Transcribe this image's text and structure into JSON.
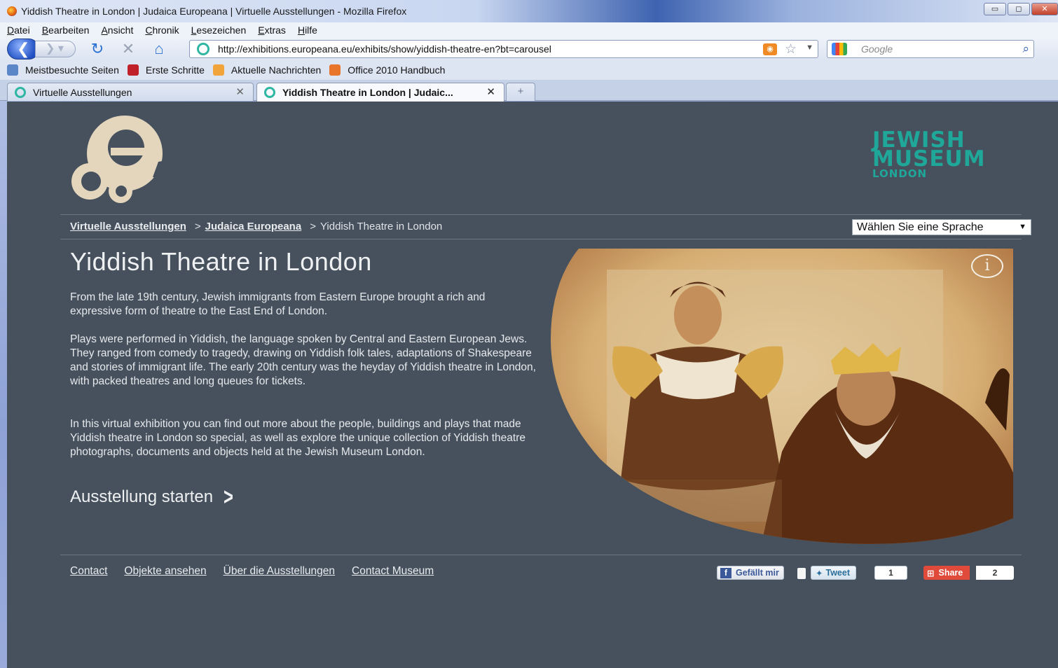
{
  "window": {
    "title": "Yiddish Theatre in London | Judaica Europeana | Virtuelle Ausstellungen - Mozilla Firefox"
  },
  "menu": [
    "Datei",
    "Bearbeiten",
    "Ansicht",
    "Chronik",
    "Lesezeichen",
    "Extras",
    "Hilfe"
  ],
  "navigation": {
    "url": "http://exhibitions.europeana.eu/exhibits/show/yiddish-theatre-en?bt=carousel",
    "search_placeholder": "Google"
  },
  "bookmarks": [
    {
      "label": "Meistbesuchte Seiten",
      "color": "#5b87c9"
    },
    {
      "label": "Erste Schritte",
      "color": "#c0202a"
    },
    {
      "label": "Aktuelle Nachrichten",
      "color": "#f0a43a"
    },
    {
      "label": "Office 2010 Handbuch",
      "color": "#e8752a"
    }
  ],
  "tabs": [
    {
      "label": "Virtuelle Ausstellungen",
      "active": false
    },
    {
      "label": "Yiddish Theatre in London | Judaic...",
      "active": true
    }
  ],
  "page": {
    "partner_logo": {
      "line1": "JEWISH",
      "line2": "MUSEUM",
      "line3": "LONDON"
    },
    "breadcrumb": {
      "item1": "Virtuelle Ausstellungen",
      "item2": "Judaica Europeana",
      "current": "Yiddish Theatre in London",
      "separator": ">"
    },
    "language_select": "Wählen Sie eine Sprache",
    "title": "Yiddish Theatre in London",
    "paragraphs": [
      "From the late 19th century, Jewish immigrants from Eastern Europe brought a rich and expressive form of theatre to the East End of London.",
      "Plays were performed in Yiddish, the language spoken by Central and Eastern European Jews. They ranged from comedy to tragedy, drawing on Yiddish folk tales, adaptations of Shakespeare and stories of immigrant life. The early 20th century was the heyday of Yiddish theatre in London, with packed theatres and long queues for tickets.",
      "In this virtual exhibition you can find out more about the people, buildings and plays that made Yiddish theatre in London so special, as well as explore the unique collection of Yiddish theatre photographs, documents and objects held at the Jewish Museum London."
    ],
    "cta": "Ausstellung starten",
    "footer_links": [
      "Contact",
      "Objekte ansehen",
      "Über die Ausstellungen",
      "Contact Museum"
    ],
    "social": {
      "facebook_label": "Gefällt mir",
      "tweet_label": "Tweet",
      "tweet_count": "1",
      "share_label": "Share",
      "share_count": "2"
    }
  },
  "colors": {
    "page_background": "#46515d",
    "accent_teal": "#1fa79a",
    "logo_beige": "#e4d6bd"
  }
}
